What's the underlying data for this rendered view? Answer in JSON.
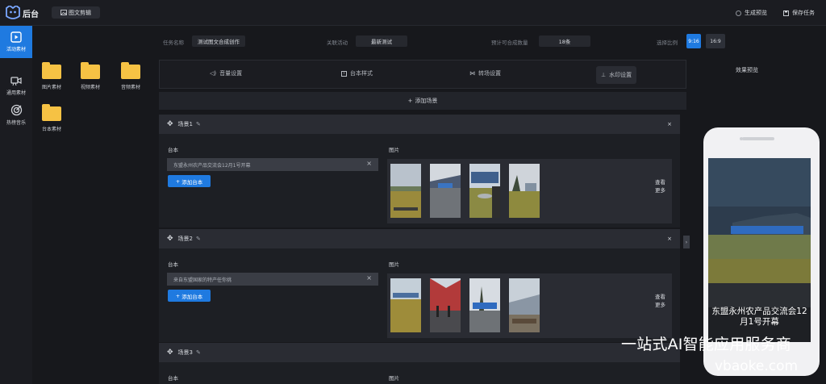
{
  "app": {
    "brand": "后台",
    "mode_button": "图文剪辑"
  },
  "topbar": {
    "generate_preview": "生成预览",
    "save_task": "保存任务"
  },
  "rail": [
    {
      "label": "活动素材",
      "icon": "play-square-icon",
      "active": true
    },
    {
      "label": "通用素材",
      "icon": "video-camera-icon",
      "active": false
    },
    {
      "label": "热榜音乐",
      "icon": "target-icon",
      "active": false
    }
  ],
  "folders": [
    "图片素材",
    "视频素材",
    "音频素材",
    "台本素材"
  ],
  "settings": {
    "task_name_label": "任务名称",
    "task_name_value": "测试图文合成创作",
    "activity_label": "关联活动",
    "activity_value": "最新测试",
    "expected_label": "预计可合成数量",
    "expected_value": "18条",
    "ratio_label": "选择比例",
    "ratio_options": [
      "9:16",
      "16:9"
    ]
  },
  "tabs": [
    "音量设置",
    "台本样式",
    "转场设置",
    "水印设置"
  ],
  "add_scene": "添加场景",
  "scenes": [
    {
      "title": "场景1",
      "script_label": "台本",
      "image_label": "图片",
      "script_line": "东盟永州农产品交流会12月1号开幕",
      "add_script": "添加台本",
      "more": [
        "查看",
        "更多"
      ]
    },
    {
      "title": "场景2",
      "script_label": "台本",
      "image_label": "图片",
      "script_line": "来自东盟国家的特产任你挑",
      "add_script": "添加台本",
      "more": [
        "查看",
        "更多"
      ]
    },
    {
      "title": "场景3",
      "script_label": "台本",
      "image_label": "图片"
    }
  ],
  "preview": {
    "title": "效果预览",
    "caption_line1": "东盟永州农产品交流会12",
    "caption_line2": "月1号开幕"
  },
  "watermark": {
    "line1": "一站式AI智能应用服务商",
    "line2": "vbaoke.com"
  },
  "colors": {
    "accent": "#1f7ae0",
    "folder": "#f6c244"
  }
}
